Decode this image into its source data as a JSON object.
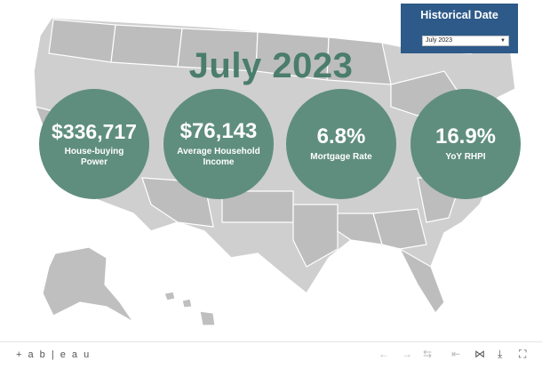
{
  "headline": "July 2023",
  "metrics": [
    {
      "value": "$336,717",
      "label_line1": "House-buying",
      "label_line2": "Power"
    },
    {
      "value": "$76,143",
      "label_line1": "Average Household",
      "label_line2": "Income"
    },
    {
      "value": "6.8%",
      "label_line1": "Mortgage Rate",
      "label_line2": ""
    },
    {
      "value": "16.9%",
      "label_line1": "YoY RHPI",
      "label_line2": ""
    }
  ],
  "filter": {
    "title": "Historical Date",
    "selected": "July 2023"
  },
  "toolbar": {
    "logo_text": "+ a b | e a u",
    "icons": [
      "undo-icon",
      "redo-icon",
      "revert-icon",
      "pause-icon",
      "share-icon",
      "download-icon",
      "fullscreen-icon"
    ]
  },
  "colors": {
    "accent": "#4a7d6c",
    "circle": "#5f8e7e",
    "filter_bg": "#2d5a89",
    "map_gray": "#c9c9c9"
  }
}
